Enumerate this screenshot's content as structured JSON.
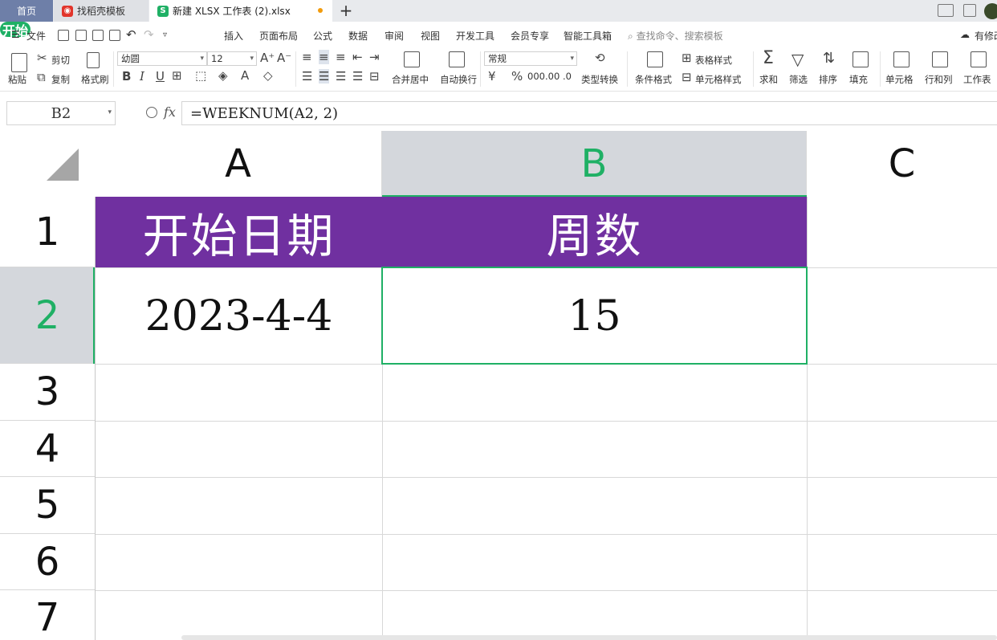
{
  "tabs": {
    "home": "首页",
    "templates": "找稻壳模板",
    "document": "新建 XLSX 工作表 (2).xlsx",
    "new_tab": "+"
  },
  "menu": {
    "file": "文件",
    "items": [
      "开始",
      "插入",
      "页面布局",
      "公式",
      "数据",
      "审阅",
      "视图",
      "开发工具",
      "会员专享",
      "智能工具箱"
    ],
    "search_placeholder": "查找命令、搜索模板",
    "collab": "有修改"
  },
  "ribbon": {
    "paste": "粘贴",
    "cut": "剪切",
    "copy": "复制",
    "format_painter": "格式刷",
    "font_name": "幼圆",
    "font_size": "12",
    "merge_center": "合并居中",
    "wrap_text": "自动换行",
    "number_format": "常规",
    "type_convert": "类型转换",
    "conditional_format": "条件格式",
    "table_style": "表格样式",
    "cell_style": "单元格样式",
    "sum": "求和",
    "filter": "筛选",
    "sort": "排序",
    "fill": "填充",
    "cell": "单元格",
    "rows_cols": "行和列",
    "worksheet": "工作表"
  },
  "formula_bar": {
    "name_box": "B2",
    "fx": "fx",
    "formula": "=WEEKNUM(A2, 2)"
  },
  "sheet": {
    "columns": [
      "A",
      "B",
      "C"
    ],
    "rows": [
      "1",
      "2",
      "3",
      "4",
      "5",
      "6",
      "7"
    ],
    "selected_cell": "B2",
    "header_fill": "#7030a0",
    "selection_color": "#1fb065",
    "cells": {
      "A1": "开始日期",
      "B1": "周数",
      "A2": "2023-4-4",
      "B2": "15"
    }
  }
}
